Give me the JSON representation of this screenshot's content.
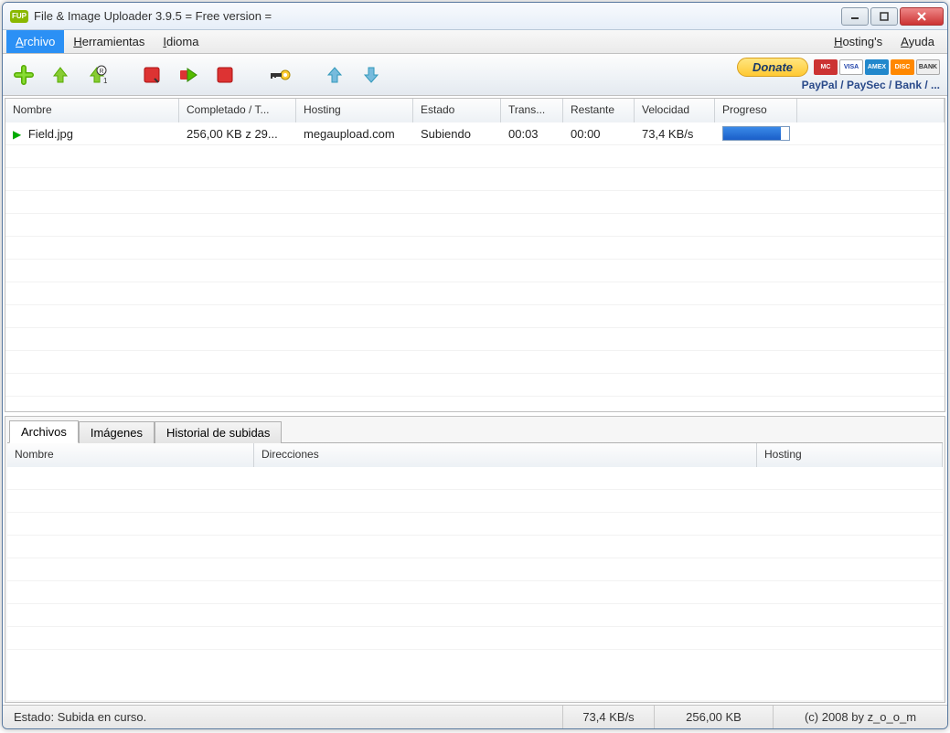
{
  "window": {
    "icon_text": "FUP",
    "title": "File & Image Uploader 3.9.5  = Free version ="
  },
  "menu": {
    "archivo_prefix": "A",
    "archivo_rest": "rchivo",
    "herramientas_prefix": "H",
    "herramientas_rest": "erramientas",
    "idioma_prefix": "I",
    "idioma_rest": "dioma",
    "hostings_prefix": "H",
    "hostings_rest": "osting's",
    "ayuda_prefix": "A",
    "ayuda_rest": "yuda"
  },
  "toolbar_icons": {
    "add": "add-icon",
    "up_green": "move-up-icon",
    "up_r": "move-up-r-icon",
    "red1": "stop-icon",
    "green_arrow": "go-icon",
    "red2": "remove-icon",
    "key": "key-icon",
    "blue_up": "blue-up-icon",
    "blue_down": "blue-down-icon"
  },
  "donate": {
    "label": "Donate",
    "subtext": "PayPal / PaySec / Bank / ...",
    "cards": [
      "MC",
      "VISA",
      "AMEX",
      "DISC",
      "BANK"
    ]
  },
  "columns": {
    "nombre": "Nombre",
    "completado": "Completado / T...",
    "hosting": "Hosting",
    "estado": "Estado",
    "trans": "Trans...",
    "restante": "Restante",
    "velocidad": "Velocidad",
    "progreso": "Progreso"
  },
  "rows": [
    {
      "nombre": "Field.jpg",
      "completado": "256,00 KB z 29...",
      "hosting": "megaupload.com",
      "estado": "Subiendo",
      "trans": "00:03",
      "restante": "00:00",
      "velocidad": "73,4 KB/s",
      "progress_pct": 88
    }
  ],
  "tabs": {
    "archivos": "Archivos",
    "imagenes": "Imágenes",
    "historial": "Historial de subidas"
  },
  "lower_columns": {
    "nombre": "Nombre",
    "direcciones": "Direcciones",
    "hosting": "Hosting"
  },
  "status": {
    "text": "Estado: Subida en curso.",
    "speed": "73,4 KB/s",
    "size": "256,00 KB",
    "copyright": "(c) 2008 by z_o_o_m"
  }
}
